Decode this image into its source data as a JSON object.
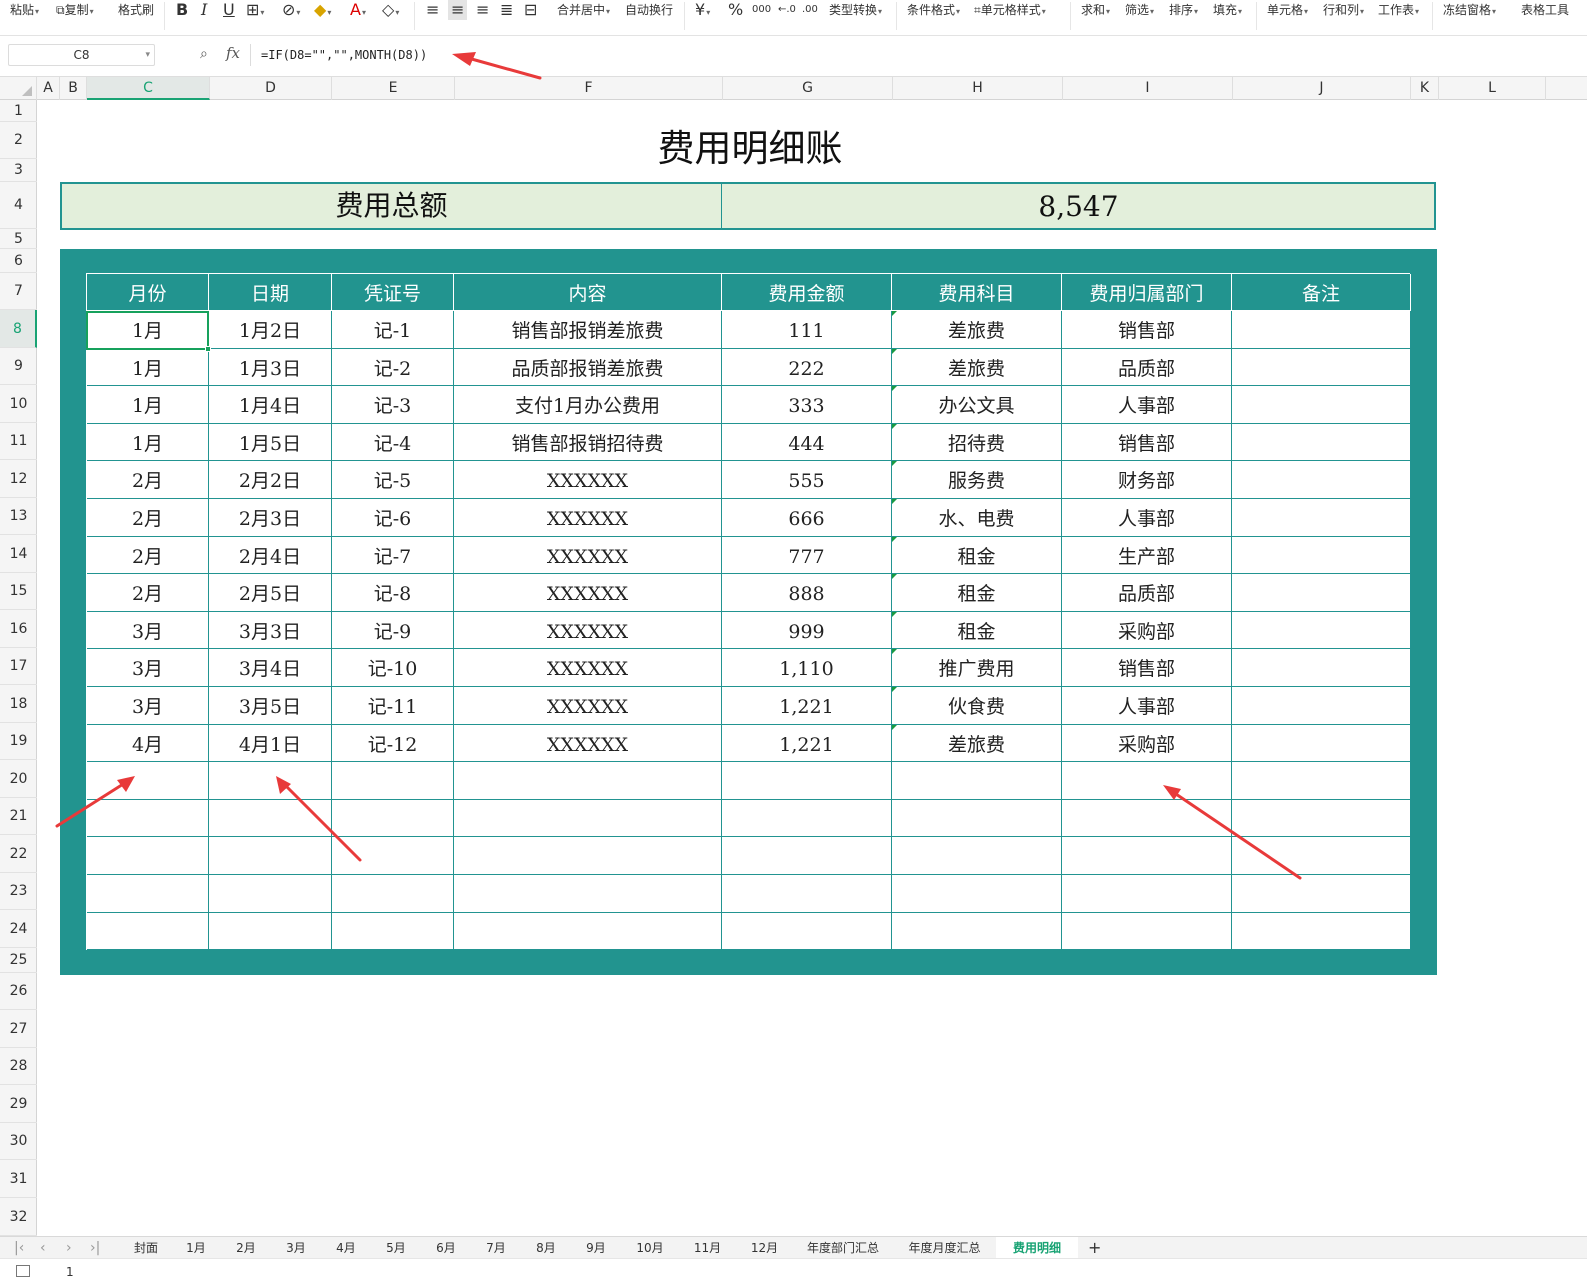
{
  "ribbon": {
    "paste": "粘贴",
    "copy": "复制",
    "format_painter": "格式刷",
    "merge_center": "合并居中",
    "wrap_text": "自动换行",
    "type_convert": "类型转换",
    "cond_format": "条件格式",
    "cell_style": "单元格样式",
    "sum": "求和",
    "filter": "筛选",
    "sort": "排序",
    "fill": "填充",
    "cell": "单元格",
    "row_col": "行和列",
    "worksheet": "工作表",
    "freeze": "冻结窗格",
    "table_tools": "表格工具"
  },
  "formula_bar": {
    "name_box": "C8",
    "formula": "=IF(D8=\"\",\"\",MONTH(D8))"
  },
  "columns": [
    "A",
    "B",
    "C",
    "D",
    "E",
    "F",
    "G",
    "H",
    "I",
    "J",
    "K",
    "L"
  ],
  "rows": [
    "1",
    "2",
    "3",
    "4",
    "5",
    "6",
    "7",
    "8",
    "9",
    "10",
    "11",
    "12",
    "13",
    "14",
    "15",
    "16",
    "17",
    "18",
    "19",
    "20",
    "21",
    "22",
    "23",
    "24",
    "25",
    "26",
    "27",
    "28",
    "29",
    "30",
    "31",
    "32"
  ],
  "sheet": {
    "title": "费用明细账",
    "total_label": "费用总额",
    "total_value": "8,547",
    "headers": [
      "月份",
      "日期",
      "凭证号",
      "内容",
      "费用金额",
      "费用科目",
      "费用归属部门",
      "备注"
    ],
    "rows": [
      [
        "1月",
        "1月2日",
        "记-1",
        "销售部报销差旅费",
        "111",
        "差旅费",
        "销售部",
        ""
      ],
      [
        "1月",
        "1月3日",
        "记-2",
        "品质部报销差旅费",
        "222",
        "差旅费",
        "品质部",
        ""
      ],
      [
        "1月",
        "1月4日",
        "记-3",
        "支付1月办公费用",
        "333",
        "办公文具",
        "人事部",
        ""
      ],
      [
        "1月",
        "1月5日",
        "记-4",
        "销售部报销招待费",
        "444",
        "招待费",
        "销售部",
        ""
      ],
      [
        "2月",
        "2月2日",
        "记-5",
        "XXXXXX",
        "555",
        "服务费",
        "财务部",
        ""
      ],
      [
        "2月",
        "2月3日",
        "记-6",
        "XXXXXX",
        "666",
        "水、电费",
        "人事部",
        ""
      ],
      [
        "2月",
        "2月4日",
        "记-7",
        "XXXXXX",
        "777",
        "租金",
        "生产部",
        ""
      ],
      [
        "2月",
        "2月5日",
        "记-8",
        "XXXXXX",
        "888",
        "租金",
        "品质部",
        ""
      ],
      [
        "3月",
        "3月3日",
        "记-9",
        "XXXXXX",
        "999",
        "租金",
        "采购部",
        ""
      ],
      [
        "3月",
        "3月4日",
        "记-10",
        "XXXXXX",
        "1,110",
        "推广费用",
        "销售部",
        ""
      ],
      [
        "3月",
        "3月5日",
        "记-11",
        "XXXXXX",
        "1,221",
        "伙食费",
        "人事部",
        ""
      ],
      [
        "4月",
        "4月1日",
        "记-12",
        "XXXXXX",
        "1,221",
        "差旅费",
        "采购部",
        ""
      ],
      [
        "",
        "",
        "",
        "",
        "",
        "",
        "",
        ""
      ],
      [
        "",
        "",
        "",
        "",
        "",
        "",
        "",
        ""
      ],
      [
        "",
        "",
        "",
        "",
        "",
        "",
        "",
        ""
      ],
      [
        "",
        "",
        "",
        "",
        "",
        "",
        "",
        ""
      ],
      [
        "",
        "",
        "",
        "",
        "",
        "",
        "",
        ""
      ]
    ]
  },
  "tabs": [
    "封面",
    "1月",
    "2月",
    "3月",
    "4月",
    "5月",
    "6月",
    "7月",
    "8月",
    "9月",
    "10月",
    "11月",
    "12月",
    "年度部门汇总",
    "年度月度汇总",
    "费用明细"
  ],
  "active_tab": "费用明细",
  "status": {
    "page": "1"
  },
  "colors": {
    "accent": "#22948f",
    "header_fill": "#e3efdb",
    "selection": "#17a15c",
    "annotation": "#e83a3a"
  }
}
